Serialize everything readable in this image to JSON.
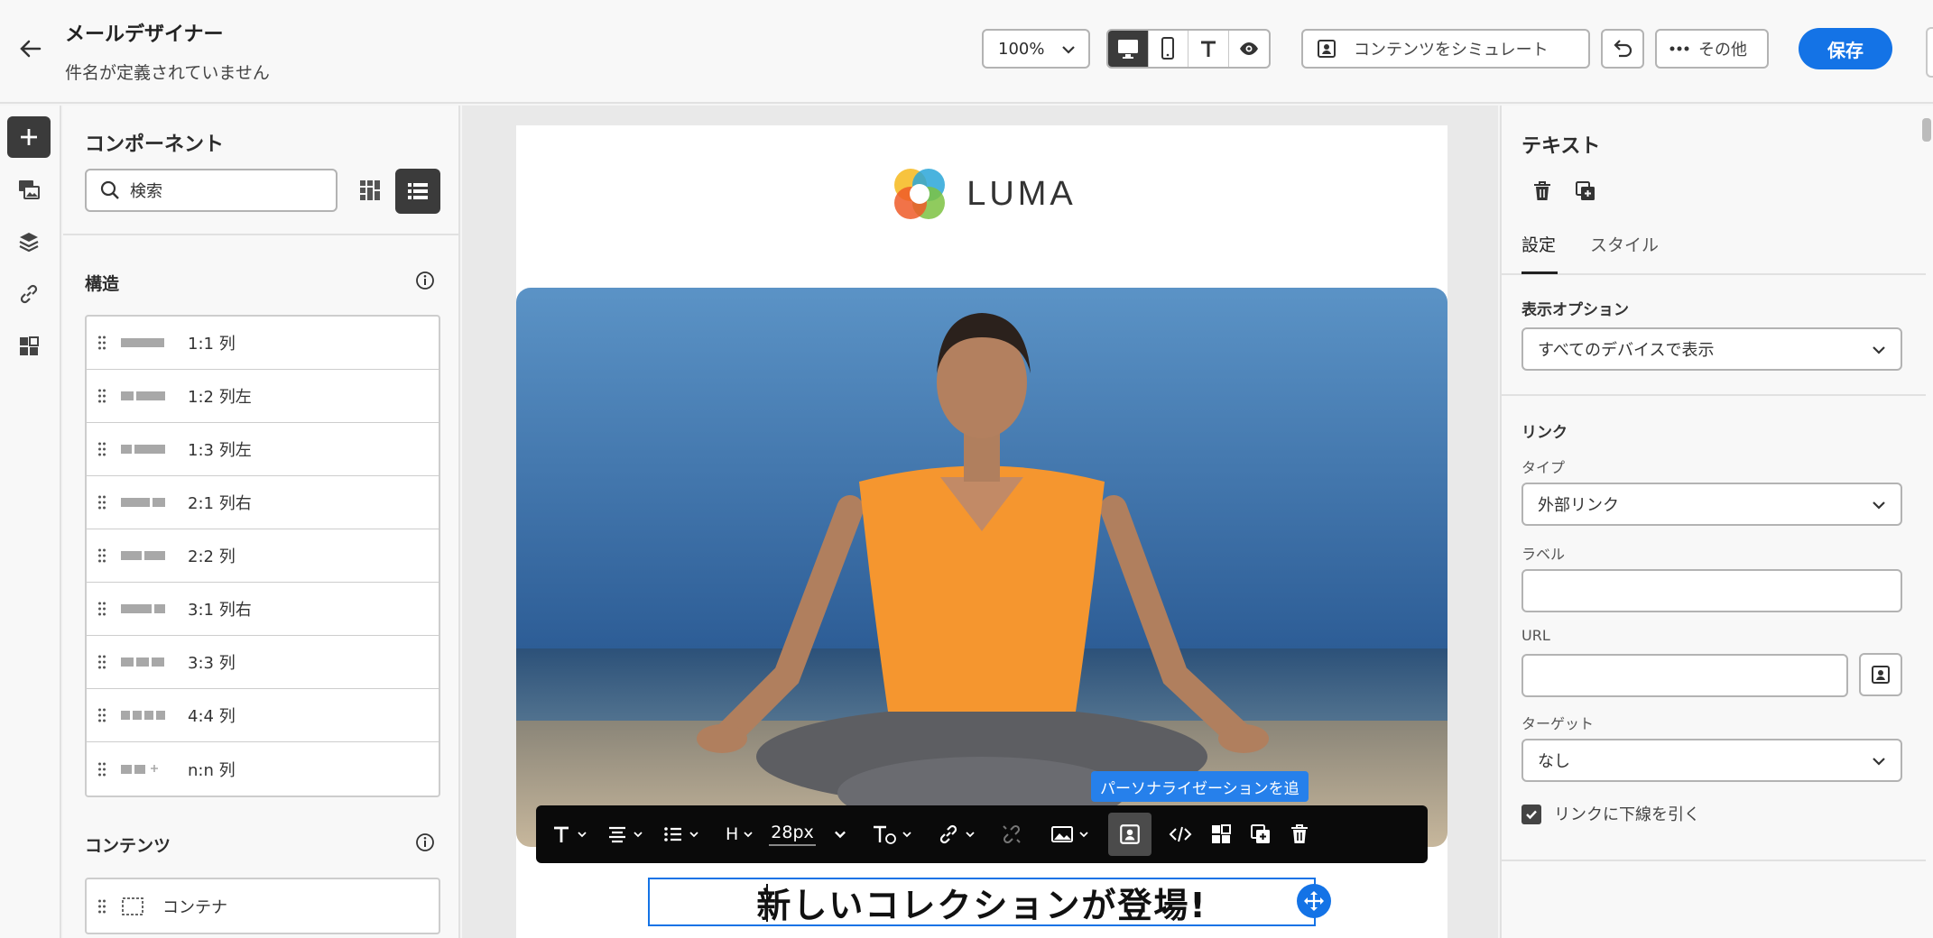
{
  "header": {
    "title": "メールデザイナー",
    "subtitle": "件名が定義されていません",
    "zoom": "100%",
    "simulate_label": "コンテンツをシミュレート",
    "more_label": "その他",
    "save_label": "保存"
  },
  "components": {
    "title": "コンポーネント",
    "search_placeholder": "検索",
    "structure_label": "構造",
    "structures": [
      {
        "label": "1:1 列"
      },
      {
        "label": "1:2 列左"
      },
      {
        "label": "1:3 列左"
      },
      {
        "label": "2:1 列右"
      },
      {
        "label": "2:2 列"
      },
      {
        "label": "3:1 列右"
      },
      {
        "label": "3:3 列"
      },
      {
        "label": "4:4 列"
      },
      {
        "label": "n:n 列"
      }
    ],
    "content_label": "コンテンツ",
    "contents": [
      {
        "label": "コンテナ"
      }
    ]
  },
  "canvas": {
    "logo_text": "LUMA",
    "tooltip": "パーソナライゼーションを追",
    "font_size": "28px",
    "heading_level": "H",
    "headline": "新しいコレクションが登場!"
  },
  "properties": {
    "title": "テキスト",
    "tabs": [
      "設定",
      "スタイル"
    ],
    "display_options_label": "表示オプション",
    "display_options_value": "すべてのデバイスで表示",
    "link_section": "リンク",
    "type_label": "タイプ",
    "type_value": "外部リンク",
    "label_label": "ラベル",
    "label_value": "",
    "url_label": "URL",
    "url_value": "",
    "target_label": "ターゲット",
    "target_value": "なし",
    "underline_label": "リンクに下線を引く",
    "underline_checked": true
  }
}
